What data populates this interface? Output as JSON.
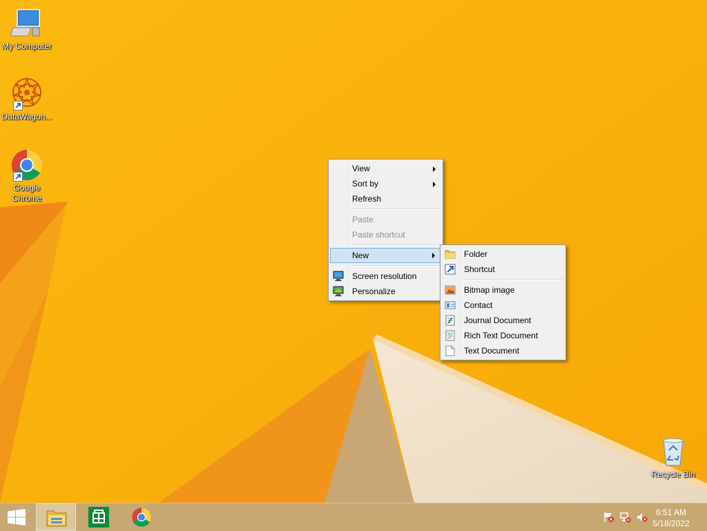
{
  "desktop": {
    "icons": [
      {
        "label": "My Computer",
        "icon": "computer-icon"
      },
      {
        "label": "DataWagon...",
        "icon": "datawagon-icon"
      },
      {
        "label": "Google Chrome",
        "icon": "chrome-icon"
      },
      {
        "label": "Recycle Bin",
        "icon": "recycle-bin-icon"
      }
    ]
  },
  "context_menu": {
    "items": [
      {
        "label": "View",
        "submenu": true
      },
      {
        "label": "Sort by",
        "submenu": true
      },
      {
        "label": "Refresh"
      },
      {
        "label": "Paste",
        "disabled": true
      },
      {
        "label": "Paste shortcut",
        "disabled": true
      },
      {
        "label": "New",
        "submenu": true,
        "highlighted": true
      },
      {
        "label": "Screen resolution",
        "icon": "screen-resolution-icon"
      },
      {
        "label": "Personalize",
        "icon": "personalize-icon"
      }
    ]
  },
  "new_submenu": {
    "items": [
      {
        "label": "Folder",
        "icon": "folder-icon"
      },
      {
        "label": "Shortcut",
        "icon": "shortcut-icon"
      },
      {
        "label": "Bitmap image",
        "icon": "bitmap-icon"
      },
      {
        "label": "Contact",
        "icon": "contact-icon"
      },
      {
        "label": "Journal Document",
        "icon": "journal-icon"
      },
      {
        "label": "Rich Text Document",
        "icon": "rich-text-icon"
      },
      {
        "label": "Text Document",
        "icon": "text-document-icon"
      }
    ]
  },
  "taskbar": {
    "buttons": [
      {
        "name": "start",
        "icon": "windows-logo-icon"
      },
      {
        "name": "file-explorer",
        "icon": "file-explorer-icon",
        "active": true
      },
      {
        "name": "store",
        "icon": "store-icon"
      },
      {
        "name": "chrome",
        "icon": "chrome-icon"
      }
    ],
    "tray": [
      {
        "icon": "action-center-flag-icon"
      },
      {
        "icon": "network-icon"
      },
      {
        "icon": "volume-muted-icon"
      }
    ],
    "clock": {
      "time": "6:51 AM",
      "date": "5/18/2022"
    }
  },
  "colors": {
    "wallpaper": "#f9b10e",
    "taskbar": "#c7a872",
    "menu_bg": "#f0f0f0",
    "menu_highlight": "#d1e2f2"
  }
}
